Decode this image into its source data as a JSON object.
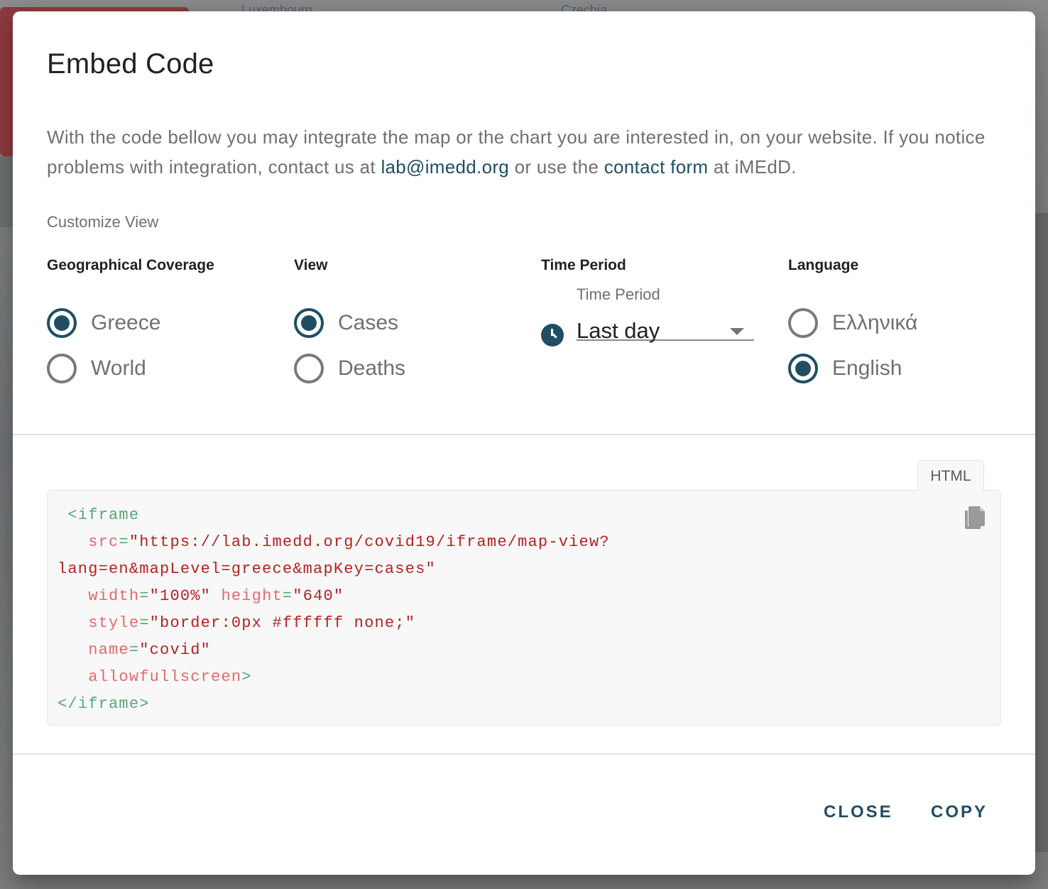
{
  "background": {
    "map_labels": [
      "Luxembourg",
      "Czechia"
    ]
  },
  "dialog": {
    "title": "Embed Code",
    "intro": {
      "text_1": "With the code bellow you may integrate the map or the chart you are interested in, on your website. If you notice problems with integration, contact us at ",
      "email_link": "lab@imedd.org",
      "text_2": " or use the ",
      "contact_link": "contact form",
      "text_3": " at iMEdD."
    },
    "customize_label": "Customize View",
    "geo": {
      "heading": "Geographical Coverage",
      "options": [
        {
          "label": "Greece",
          "checked": true
        },
        {
          "label": "World",
          "checked": false
        }
      ]
    },
    "view": {
      "heading": "View",
      "options": [
        {
          "label": "Cases",
          "checked": true
        },
        {
          "label": "Deaths",
          "checked": false
        }
      ]
    },
    "time_period": {
      "heading": "Time Period",
      "field_label": "Time Period",
      "selected": "Last day",
      "icon": "clock-icon"
    },
    "language": {
      "heading": "Language",
      "options": [
        {
          "label": "Ελληνικά",
          "checked": false
        },
        {
          "label": "English",
          "checked": true
        }
      ]
    },
    "code_tab": "HTML",
    "code": {
      "open_tag": "<iframe",
      "src_attr": "src",
      "src_value_1": "\"https://lab.imedd.org/covid19/iframe/map-view?",
      "src_value_2": "lang=en&mapLevel=greece&mapKey=cases\"",
      "width_attr": "width",
      "width_value": "\"100%\"",
      "height_attr": "height",
      "height_value": "\"640\"",
      "style_attr": "style",
      "style_value": "\"border:0px #ffffff none;\"",
      "name_attr": "name",
      "name_value": "\"covid\"",
      "allow_attr": "allowfullscreen",
      "gt": ">",
      "eq": "=",
      "close_tag": "</iframe>"
    },
    "actions": {
      "close": "CLOSE",
      "copy": "COPY"
    }
  },
  "colors": {
    "accent": "#1f4e63",
    "text_muted": "#707070",
    "code_tag": "#55a777",
    "code_attr": "#e36a6a",
    "code_value": "#b52222"
  }
}
